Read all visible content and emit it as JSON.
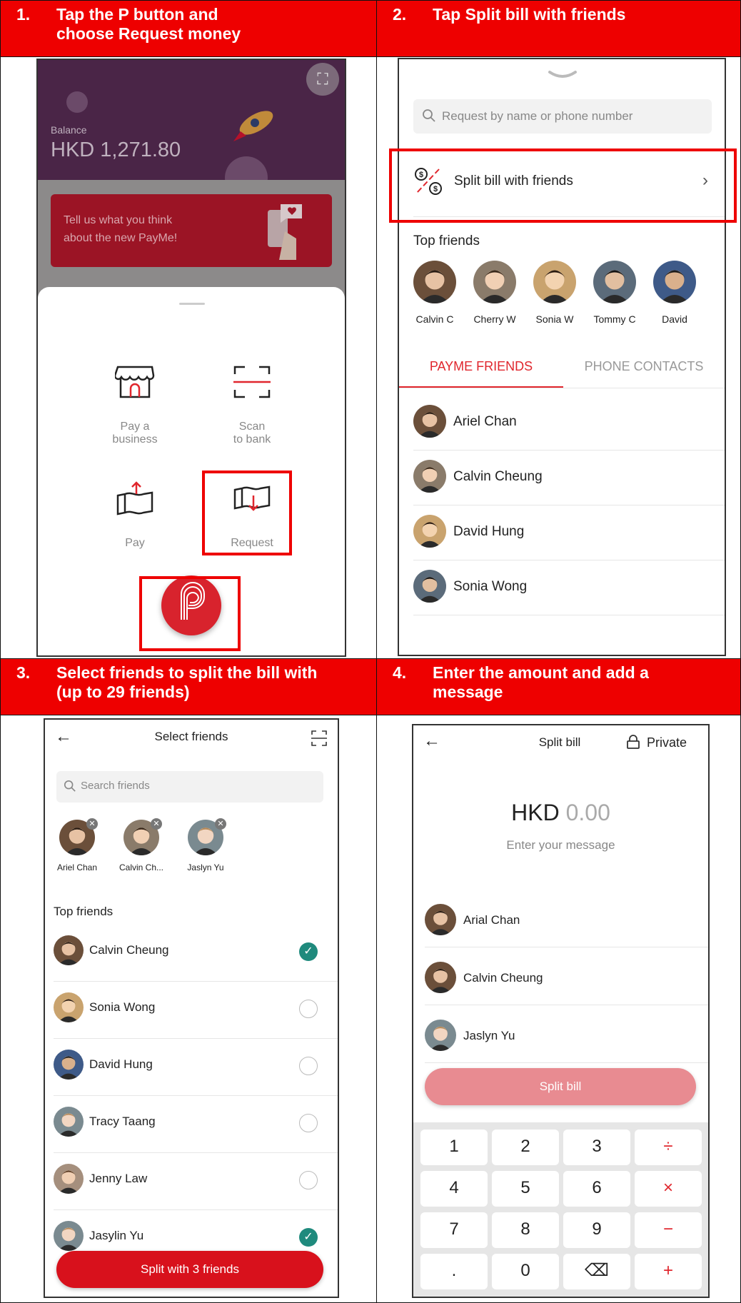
{
  "steps": [
    {
      "num": "1.",
      "line1": "Tap the P button and",
      "line2": "choose Request money"
    },
    {
      "num": "2.",
      "line1": "Tap Split bill with friends",
      "line2": ""
    },
    {
      "num": "3.",
      "line1": "Select friends to split the bill with",
      "line2": "(up to 29 friends)"
    },
    {
      "num": "4.",
      "line1": "Enter the amount and add a",
      "line2": "message"
    }
  ],
  "screen1": {
    "balance_label": "Balance",
    "balance_value": "HKD 1,271.80",
    "banner_line1": "Tell us what you think",
    "banner_line2": "about the new PayMe!",
    "actions": [
      {
        "line1": "Pay a",
        "line2": "business",
        "icon": "storefront-icon"
      },
      {
        "line1": "Scan",
        "line2": "to bank",
        "icon": "scan-icon"
      },
      {
        "line1": "Pay",
        "line2": "",
        "icon": "send-money-icon"
      },
      {
        "line1": "Request",
        "line2": "",
        "icon": "request-money-icon"
      }
    ],
    "colors": {
      "accent": "#e0262d",
      "banner": "#b5112a",
      "header_bg": "#4a2547"
    }
  },
  "screen2": {
    "search_placeholder": "Request by name or phone number",
    "split_label": "Split bill with friends",
    "top_friends_title": "Top friends",
    "top_friends": [
      "Calvin C",
      "Cherry W",
      "Sonia W",
      "Tommy C",
      "David"
    ],
    "tabs": [
      "PAYME FRIENDS",
      "PHONE CONTACTS"
    ],
    "friends": [
      "Ariel Chan",
      "Calvin Cheung",
      "David Hung",
      "Sonia Wong"
    ]
  },
  "screen3": {
    "title": "Select friends",
    "search_placeholder": "Search friends",
    "selected": [
      "Ariel Chan",
      "Calvin Ch...",
      "Jaslyn Yu"
    ],
    "top_friends_title": "Top friends",
    "friends": [
      {
        "name": "Calvin Cheung",
        "checked": true
      },
      {
        "name": "Sonia Wong",
        "checked": false
      },
      {
        "name": "David Hung",
        "checked": false
      },
      {
        "name": "Tracy Taang",
        "checked": false
      },
      {
        "name": "Jenny Law",
        "checked": false
      },
      {
        "name": "Jasylin Yu",
        "checked": true
      }
    ],
    "button_label": "Split with 3 friends"
  },
  "screen4": {
    "title": "Split bill",
    "privacy_label": "Private",
    "currency": "HKD",
    "amount": "0.00",
    "message_placeholder": "Enter your message",
    "people": [
      "Arial Chan",
      "Calvin Cheung",
      "Jaslyn Yu"
    ],
    "button_label": "Split bill",
    "keys": [
      "1",
      "2",
      "3",
      "÷",
      "4",
      "5",
      "6",
      "×",
      "7",
      "8",
      "9",
      "−",
      ".",
      "0",
      "⌫",
      "+"
    ]
  }
}
